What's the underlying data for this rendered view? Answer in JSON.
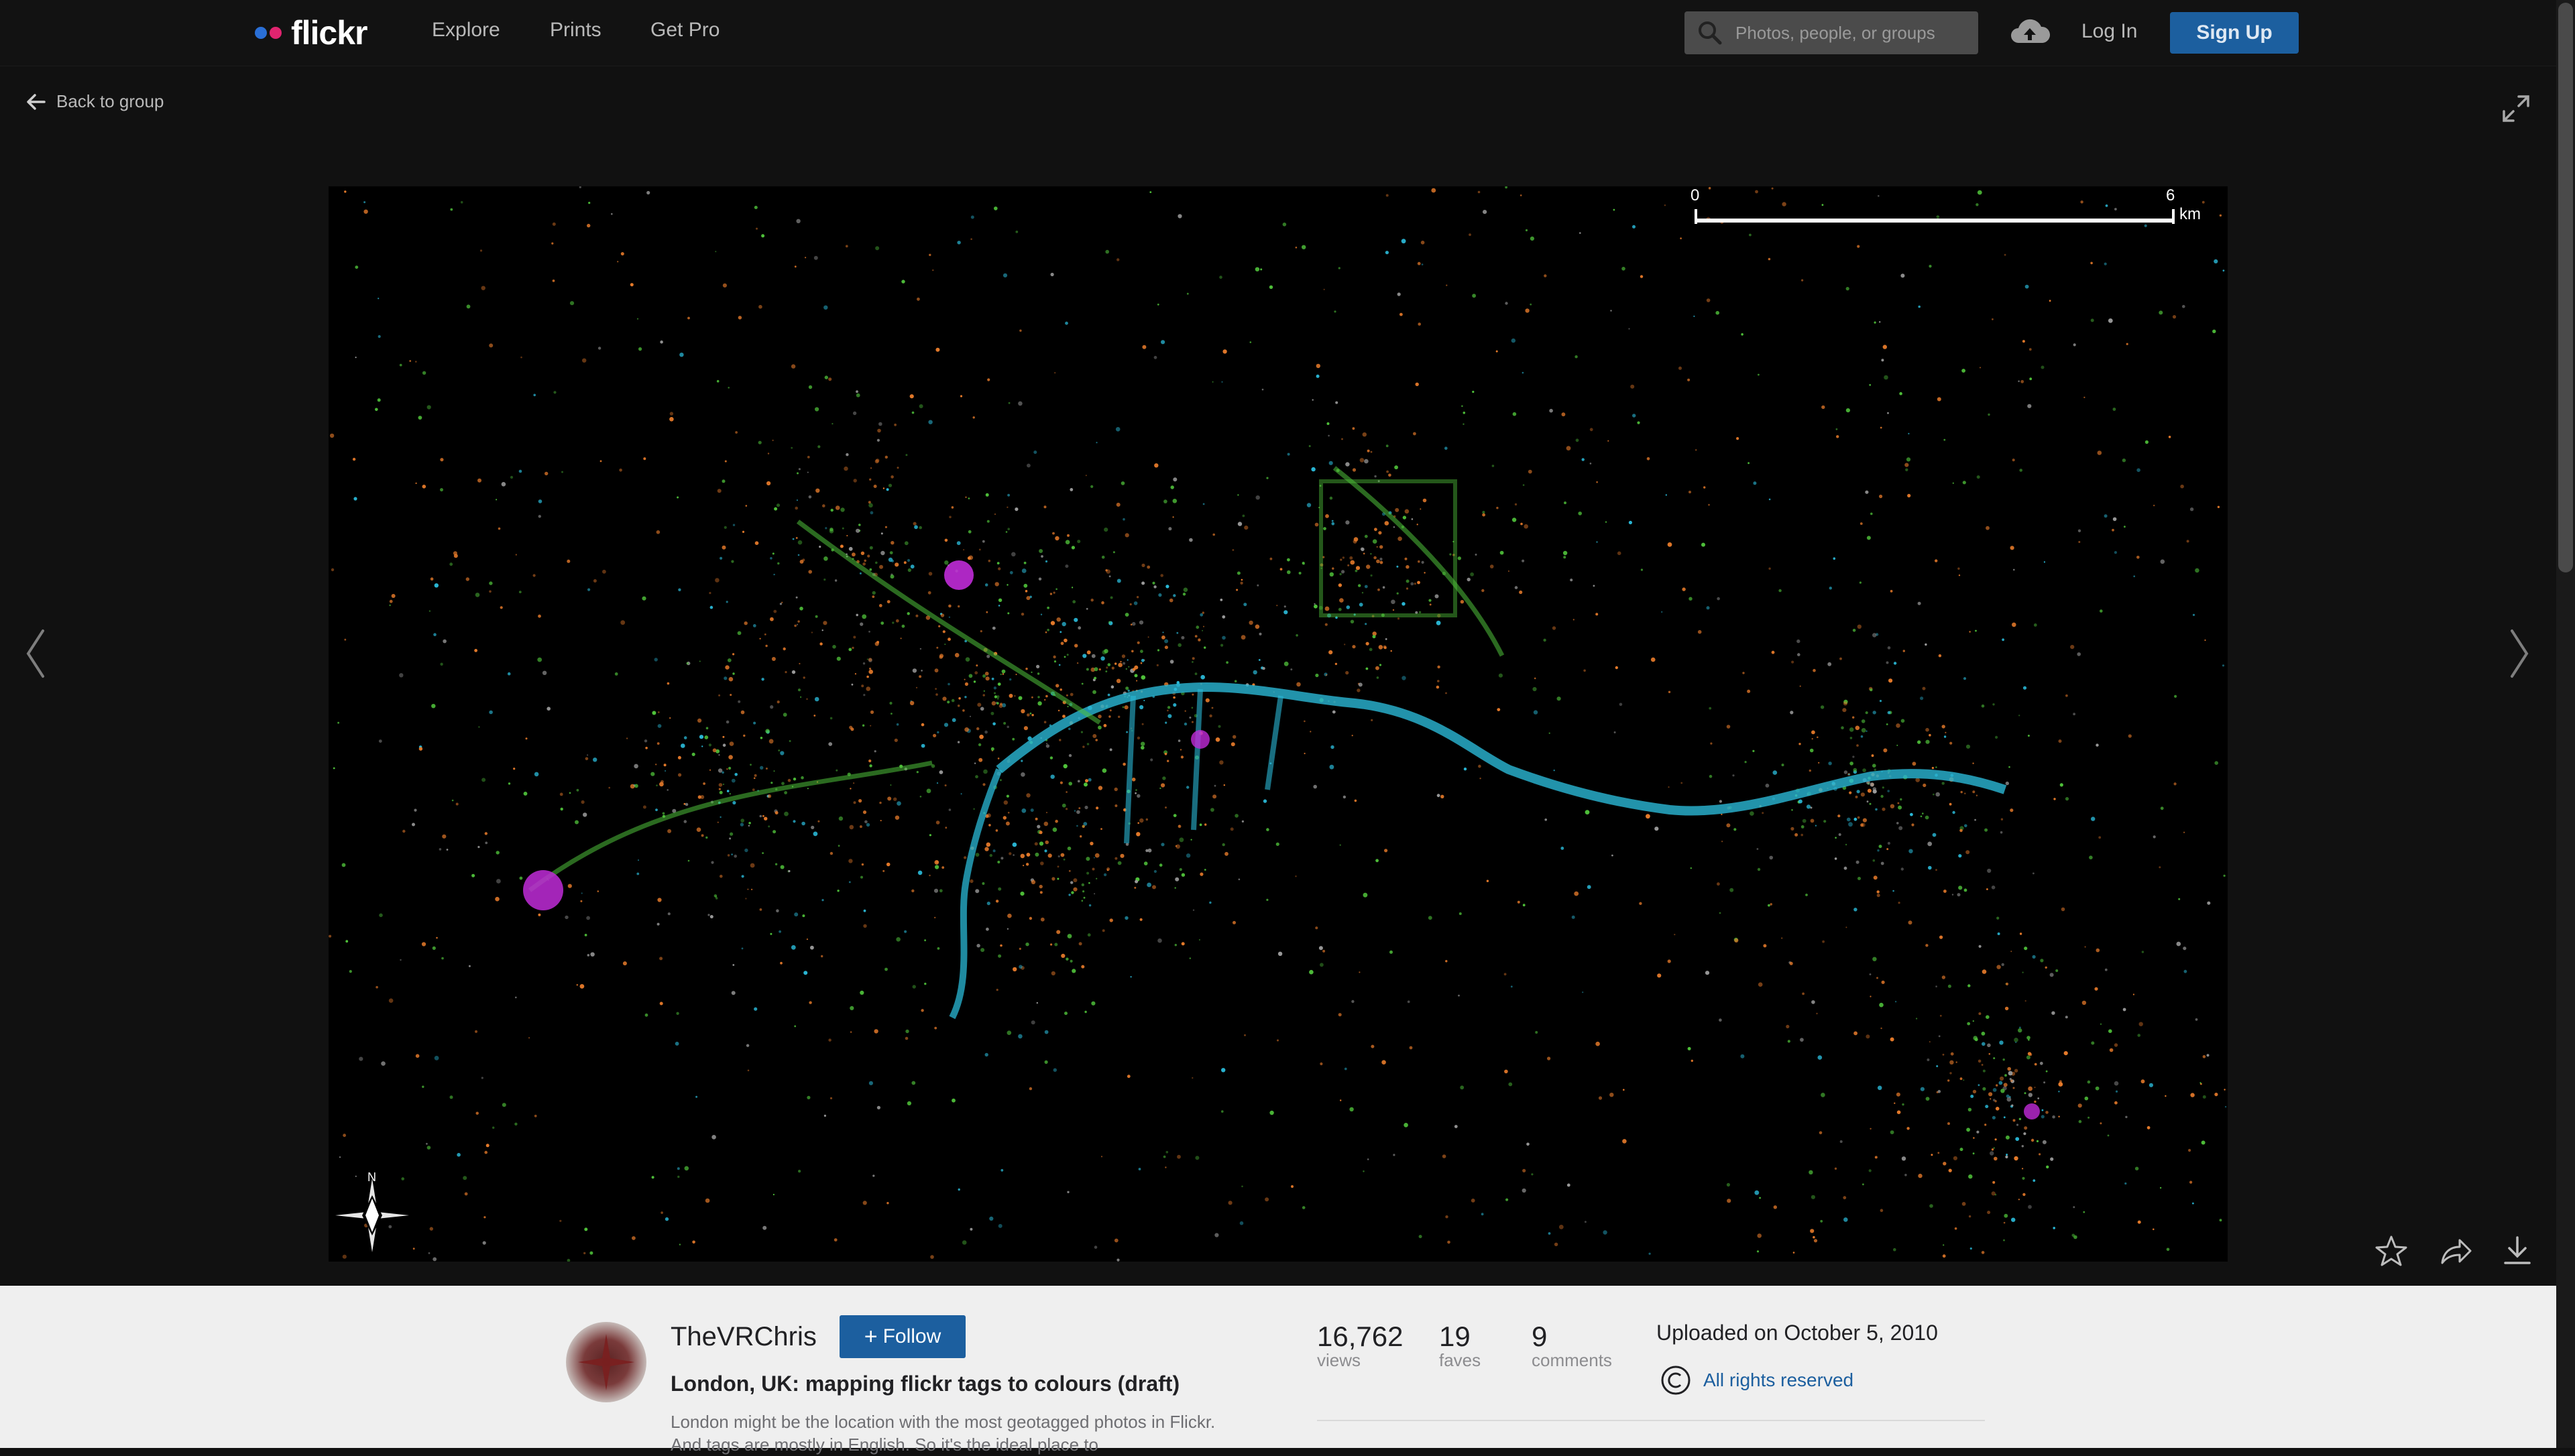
{
  "brand": {
    "name": "flickr",
    "dot_blue": "#0063dc",
    "dot_pink": "#ff0084",
    "accent": "#1c5f9f"
  },
  "nav": {
    "explore": "Explore",
    "prints": "Prints",
    "get_pro": "Get Pro"
  },
  "search": {
    "placeholder": "Photos, people, or groups"
  },
  "auth": {
    "login": "Log In",
    "signup": "Sign Up"
  },
  "stage": {
    "back_label": "Back to group",
    "icons": [
      "arrow-left-icon",
      "expand-icon",
      "chevron-left-icon",
      "chevron-right-icon",
      "star-icon",
      "share-icon",
      "download-icon"
    ]
  },
  "photo": {
    "scale_start": "0",
    "scale_end": "6",
    "scale_unit": "km",
    "compass_label": "N"
  },
  "owner": {
    "name": "TheVRChris",
    "follow_label": "Follow"
  },
  "info": {
    "title": "London, UK: mapping flickr tags to colours (draft)",
    "description": "London might be the location with the most geotagged photos in Flickr. And tags are mostly in English. So it's the ideal place to"
  },
  "stats": {
    "views_value": "16,762",
    "views_label": "views",
    "faves_value": "19",
    "faves_label": "faves",
    "comments_value": "9",
    "comments_label": "comments"
  },
  "meta": {
    "uploaded": "Uploaded on October 5, 2010",
    "rights": "All rights reserved"
  }
}
